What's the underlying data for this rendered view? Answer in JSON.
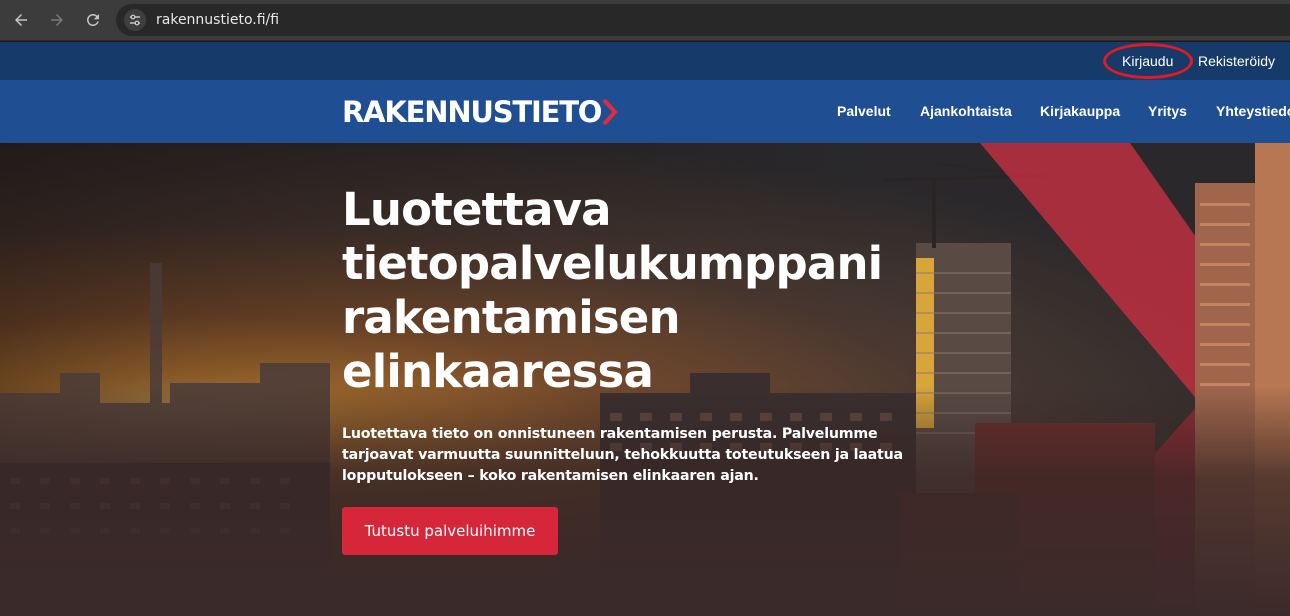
{
  "browser": {
    "url": "rakennustieto.fi/fi",
    "icons": [
      "back-arrow-icon",
      "forward-arrow-icon",
      "reload-icon",
      "site-info-icon"
    ]
  },
  "utility_nav": {
    "login": "Kirjaudu",
    "register": "Rekisteröidy",
    "highlight_color": "#e01b24"
  },
  "header": {
    "logo": "RAKENNUSTIETO",
    "nav": [
      "Palvelut",
      "Ajankohtaista",
      "Kirjakauppa",
      "Yritys",
      "Yhteystiedot"
    ]
  },
  "hero": {
    "title": "Luotettava tietopalvelukumppani rakentamisen elinkaaressa",
    "text": "Luotettava tieto on onnistuneen rakentamisen perusta. Palvelumme tarjoavat varmuutta suunnitteluun, tehokkuutta toteutukseen ja laatua lopputulokseen – koko rakentamisen elinkaaren ajan.",
    "cta": "Tutustu palveluihimme"
  },
  "colors": {
    "utility_bar": "#163a69",
    "header": "#1f4e93",
    "accent_red": "#d5263a"
  }
}
